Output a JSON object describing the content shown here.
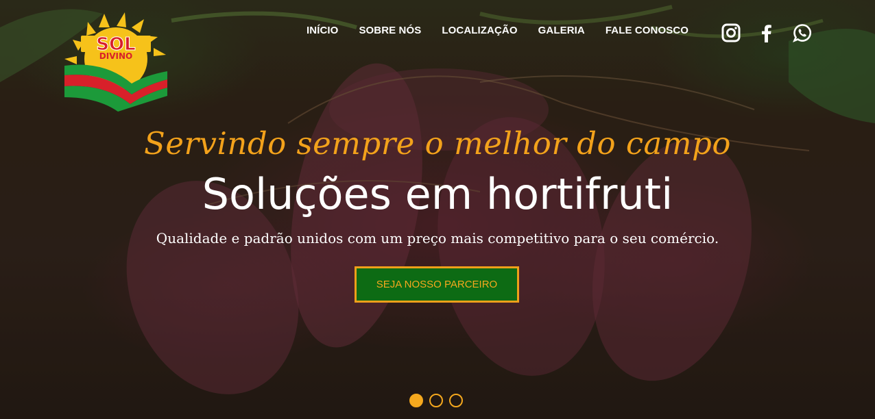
{
  "brand": {
    "line1": "SOL",
    "line2": "DIVINO"
  },
  "nav": {
    "items": [
      {
        "label": "INÍCIO"
      },
      {
        "label": "SOBRE NÓS"
      },
      {
        "label": "LOCALIZAÇÃO"
      },
      {
        "label": "GALERIA"
      },
      {
        "label": "FALE CONOSCO"
      }
    ]
  },
  "social": {
    "icons": [
      "instagram-icon",
      "facebook-icon",
      "whatsapp-icon"
    ]
  },
  "hero": {
    "tagline": "Servindo sempre o melhor do campo",
    "headline": "Soluções em hortifruti",
    "subline": "Qualidade e padrão unidos com um preço mais competitivo para o seu comércio.",
    "cta_label": "SEJA NOSSO PARCEIRO"
  },
  "carousel": {
    "slide_count": 3,
    "active_index": 0
  },
  "colors": {
    "accent": "#f5a81e",
    "cta_bg": "#0d6b14",
    "logo_red": "#d8202a",
    "logo_green": "#1c9a3a",
    "logo_yellow": "#f6c21a"
  }
}
